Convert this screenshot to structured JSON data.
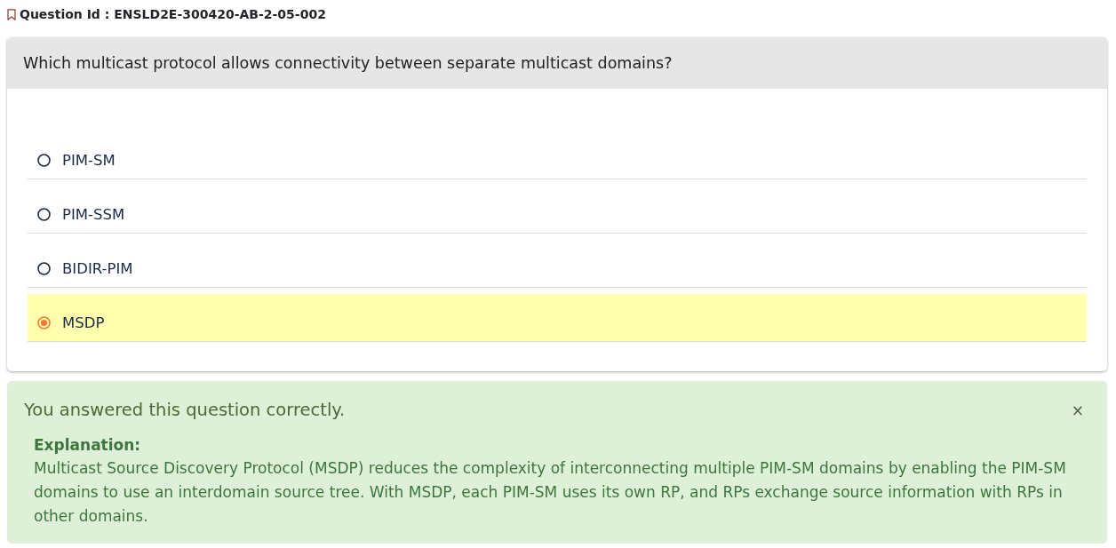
{
  "question_id": "Question Id : ENSLD2E-300420-AB-2-05-002",
  "question": {
    "text": "Which multicast protocol allows connectivity between separate multicast domains?",
    "options": [
      {
        "label": "PIM-SM",
        "selected": false
      },
      {
        "label": "PIM-SSM",
        "selected": false
      },
      {
        "label": "BIDIR-PIM",
        "selected": false
      },
      {
        "label": "MSDP",
        "selected": true
      }
    ]
  },
  "result": {
    "message": "You answered this question correctly.",
    "close": "×",
    "explanation_title": "Explanation:",
    "explanation": "Multicast Source Discovery Protocol (MSDP) reduces the complexity of interconnecting multiple PIM-SM domains by enabling the PIM-SM domains to use an interdomain source tree. With MSDP, each PIM-SM uses its own RP, and RPs exchange source information with RPs in other domains."
  }
}
